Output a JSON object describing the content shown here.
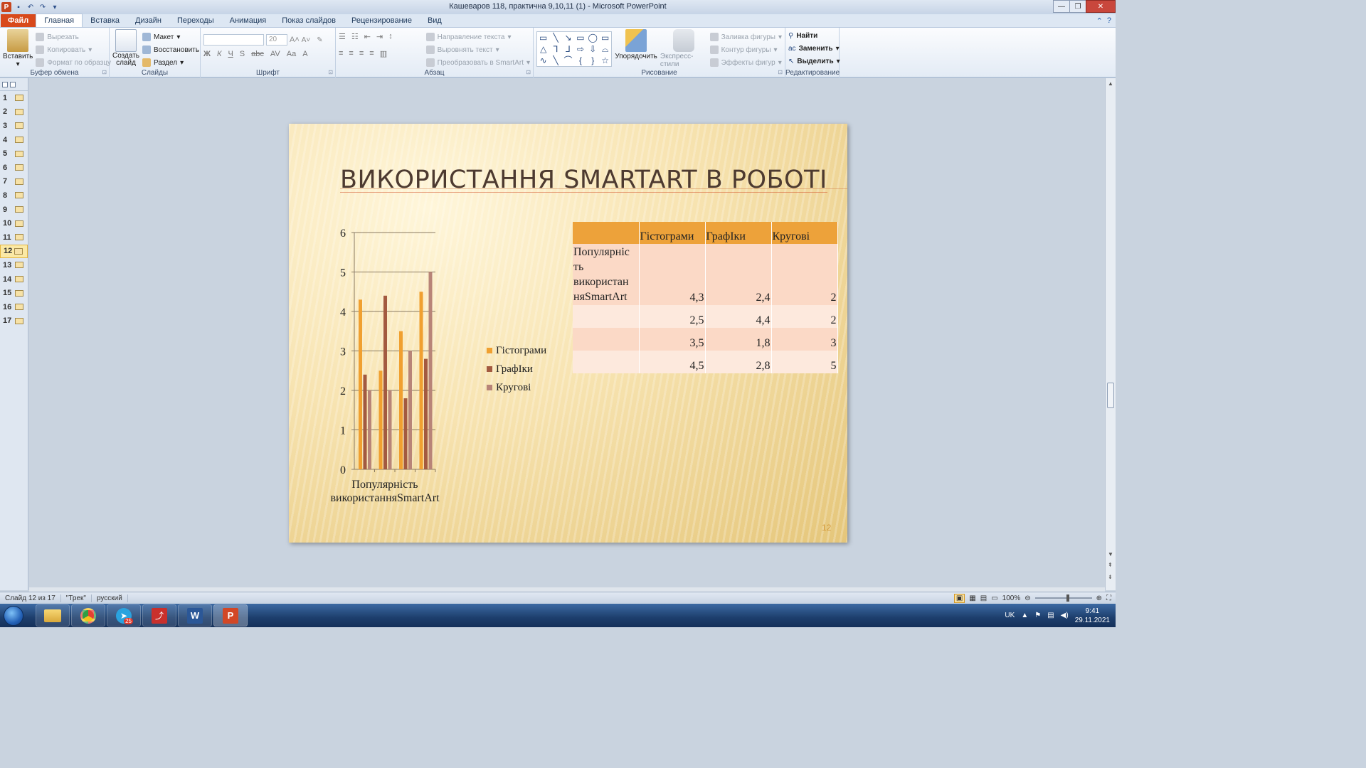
{
  "window": {
    "title": "Кашеваров 118, практична 9,10,11 (1)  -  Microsoft PowerPoint"
  },
  "tabs": [
    "Файл",
    "Главная",
    "Вставка",
    "Дизайн",
    "Переходы",
    "Анимация",
    "Показ слайдов",
    "Рецензирование",
    "Вид"
  ],
  "ribbon": {
    "clipboard": {
      "paste": "Вставить",
      "cut": "Вырезать",
      "copy": "Копировать",
      "format_painter": "Формат по образцу",
      "label": "Буфер обмена"
    },
    "slides": {
      "new_slide": "Создать слайд",
      "layout": "Макет",
      "reset": "Восстановить",
      "section": "Раздел",
      "label": "Слайды"
    },
    "font": {
      "size": "20",
      "label": "Шрифт",
      "bold": "Ж",
      "italic": "К",
      "underline": "Ч",
      "shadow": "S",
      "strike": "abc",
      "spacing": "AV",
      "case": "Aa"
    },
    "paragraph": {
      "text_direction": "Направление текста",
      "align_text": "Выровнять текст",
      "smartart": "Преобразовать в SmartArt",
      "label": "Абзац"
    },
    "drawing": {
      "arrange": "Упорядочить",
      "quick_styles": "Экспресс-стили",
      "fill": "Заливка фигуры",
      "outline": "Контур фигуры",
      "effects": "Эффекты фигур",
      "label": "Рисование"
    },
    "editing": {
      "find": "Найти",
      "replace": "Заменить",
      "select": "Выделить",
      "label": "Редактирование"
    }
  },
  "thumbnails": [
    "1",
    "2",
    "3",
    "4",
    "5",
    "6",
    "7",
    "8",
    "9",
    "10",
    "11",
    "12",
    "13",
    "14",
    "15",
    "16",
    "17"
  ],
  "current_slide": "12",
  "slide": {
    "title": "Використання SmartArt в роботі",
    "page_number": "12",
    "legend": [
      "Гістограми",
      "ГрафІки",
      "Кругові"
    ],
    "table": {
      "headers": [
        "",
        "Гістограми",
        "ГрафІки",
        "Кругові"
      ],
      "rows": [
        {
          "label": "Популярніс ть використан няSmartArt",
          "values": [
            "4,3",
            "2,4",
            "2"
          ]
        },
        {
          "label": "",
          "values": [
            "2,5",
            "4,4",
            "2"
          ]
        },
        {
          "label": "",
          "values": [
            "3,5",
            "1,8",
            "3"
          ]
        },
        {
          "label": "",
          "values": [
            "4,5",
            "2,8",
            "5"
          ]
        }
      ]
    }
  },
  "chart_data": {
    "type": "bar",
    "categories": [
      "ПопулярністьвикористанняSmartArt",
      "",
      "",
      ""
    ],
    "category_label_lines": [
      "Популярність",
      "використанняSmartArt"
    ],
    "series": [
      {
        "name": "Гістограми",
        "values": [
          4.3,
          2.5,
          3.5,
          4.5
        ],
        "color": "#f0a030"
      },
      {
        "name": "ГрафІки",
        "values": [
          2.4,
          4.4,
          1.8,
          2.8
        ],
        "color": "#a35a40"
      },
      {
        "name": "Кругові",
        "values": [
          2,
          2,
          3,
          5
        ],
        "color": "#b88478"
      }
    ],
    "yticks": [
      "0",
      "1",
      "2",
      "3",
      "4",
      "5",
      "6"
    ],
    "ylim": [
      0,
      6
    ],
    "legend_position": "right",
    "grid": true
  },
  "status": {
    "slide_info": "Слайд 12 из 17",
    "theme": "\"Трек\"",
    "language": "русский",
    "zoom": "100%"
  },
  "taskbar": {
    "lang": "UK",
    "time": "9:41",
    "date": "29.11.2021",
    "telegram_badge": "25"
  },
  "colors": {
    "accent": "#d8491b",
    "series1": "#f0a030",
    "series2": "#a35a40",
    "series3": "#b88478"
  }
}
